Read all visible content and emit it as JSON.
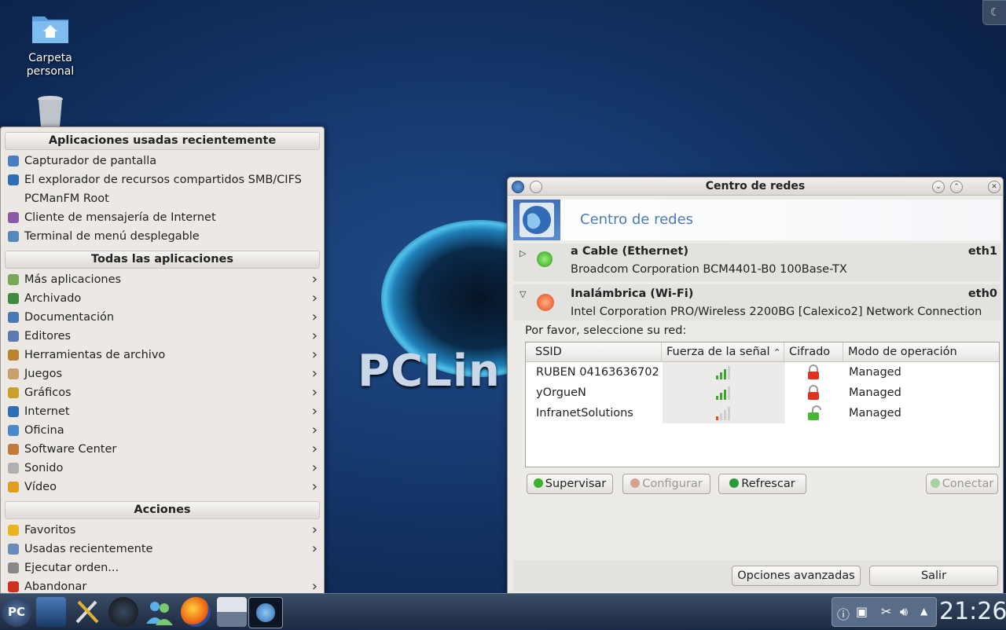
{
  "desktop": {
    "icons": [
      {
        "label_line1": "Carpeta",
        "label_line2": "personal"
      }
    ],
    "logo_text": "PCLin"
  },
  "menu": {
    "sections": [
      {
        "header": "Aplicaciones usadas recientemente",
        "items": [
          {
            "label": "Capturador de pantalla",
            "icon": "screenshot-icon",
            "color": "#4a7cc0",
            "submenu": false
          },
          {
            "label": "El explorador de recursos compartidos SMB/CIFS",
            "icon": "globe-icon",
            "color": "#2f6db5",
            "submenu": false
          },
          {
            "label": "PCManFM Root",
            "icon": "",
            "color": "",
            "submenu": false
          },
          {
            "label": "Cliente de mensajería de Internet",
            "icon": "pidgin-icon",
            "color": "#8a5aa8",
            "submenu": false
          },
          {
            "label": "Terminal de menú desplegable",
            "icon": "terminal-icon",
            "color": "#5588bb",
            "submenu": false
          }
        ]
      },
      {
        "header": "Todas las aplicaciones",
        "items": [
          {
            "label": "Más aplicaciones",
            "icon": "more-apps-icon",
            "color": "#7aa85a",
            "submenu": true
          },
          {
            "label": "Archivado",
            "icon": "archive-icon",
            "color": "#3f8a3f",
            "submenu": true
          },
          {
            "label": "Documentación",
            "icon": "documentation-icon",
            "color": "#4a78b5",
            "submenu": true
          },
          {
            "label": "Editores",
            "icon": "editor-icon",
            "color": "#5a7ab0",
            "submenu": true
          },
          {
            "label": "Herramientas de archivo",
            "icon": "file-tools-icon",
            "color": "#b8862e",
            "submenu": true
          },
          {
            "label": "Juegos",
            "icon": "games-icon",
            "color": "#c9a070",
            "submenu": true
          },
          {
            "label": "Gráficos",
            "icon": "graphics-icon",
            "color": "#c8a02a",
            "submenu": true
          },
          {
            "label": "Internet",
            "icon": "internet-icon",
            "color": "#2f6db5",
            "submenu": true
          },
          {
            "label": "Oficina",
            "icon": "office-icon",
            "color": "#4a88c8",
            "submenu": true
          },
          {
            "label": "Software Center",
            "icon": "software-center-icon",
            "color": "#c07a3a",
            "submenu": true
          },
          {
            "label": "Sonido",
            "icon": "sound-icon",
            "color": "#b0b0b0",
            "submenu": true
          },
          {
            "label": "Vídeo",
            "icon": "video-icon",
            "color": "#e0a020",
            "submenu": true
          }
        ]
      },
      {
        "header": "Acciones",
        "items": [
          {
            "label": "Favoritos",
            "icon": "star-icon",
            "color": "#e8b420",
            "submenu": true
          },
          {
            "label": "Usadas recientemente",
            "icon": "recent-icon",
            "color": "#6a8ab8",
            "submenu": true
          },
          {
            "label": "Ejecutar orden...",
            "icon": "run-icon",
            "color": "#888888",
            "submenu": false
          },
          {
            "label": "Abandonar",
            "icon": "power-icon",
            "color": "#d03020",
            "submenu": true
          }
        ]
      }
    ]
  },
  "window": {
    "title": "Centro de redes",
    "banner_title": "Centro de redes",
    "ethernet": {
      "name": "a Cable (Ethernet)",
      "description": "Broadcom Corporation BCM4401-B0 100Base-TX",
      "interface": "eth1"
    },
    "wifi": {
      "name": "Inalámbrica (Wi-Fi)",
      "description": "Intel Corporation PRO/Wireless 2200BG [Calexico2] Network Connection",
      "interface": "eth0",
      "prompt": "Por favor, seleccione su red:"
    },
    "table": {
      "columns": [
        "SSID",
        "Fuerza de la señal",
        "Cifrado",
        "Modo de operación"
      ],
      "rows": [
        {
          "ssid": "RUBEN 04163636702",
          "signal_bars": 3,
          "locked": true,
          "mode": "Managed"
        },
        {
          "ssid": "yOrgueN",
          "signal_bars": 3,
          "locked": true,
          "mode": "Managed"
        },
        {
          "ssid": "InfranetSolutions",
          "signal_bars": 1,
          "locked": false,
          "mode": "Managed"
        }
      ]
    },
    "buttons": {
      "supervisar": "Supervisar",
      "configurar": "Configurar",
      "refrescar": "Refrescar",
      "conectar": "Conectar",
      "opciones": "Opciones avanzadas",
      "salir": "Salir"
    }
  },
  "taskbar": {
    "start_label": "PC",
    "clock": "21:26"
  }
}
